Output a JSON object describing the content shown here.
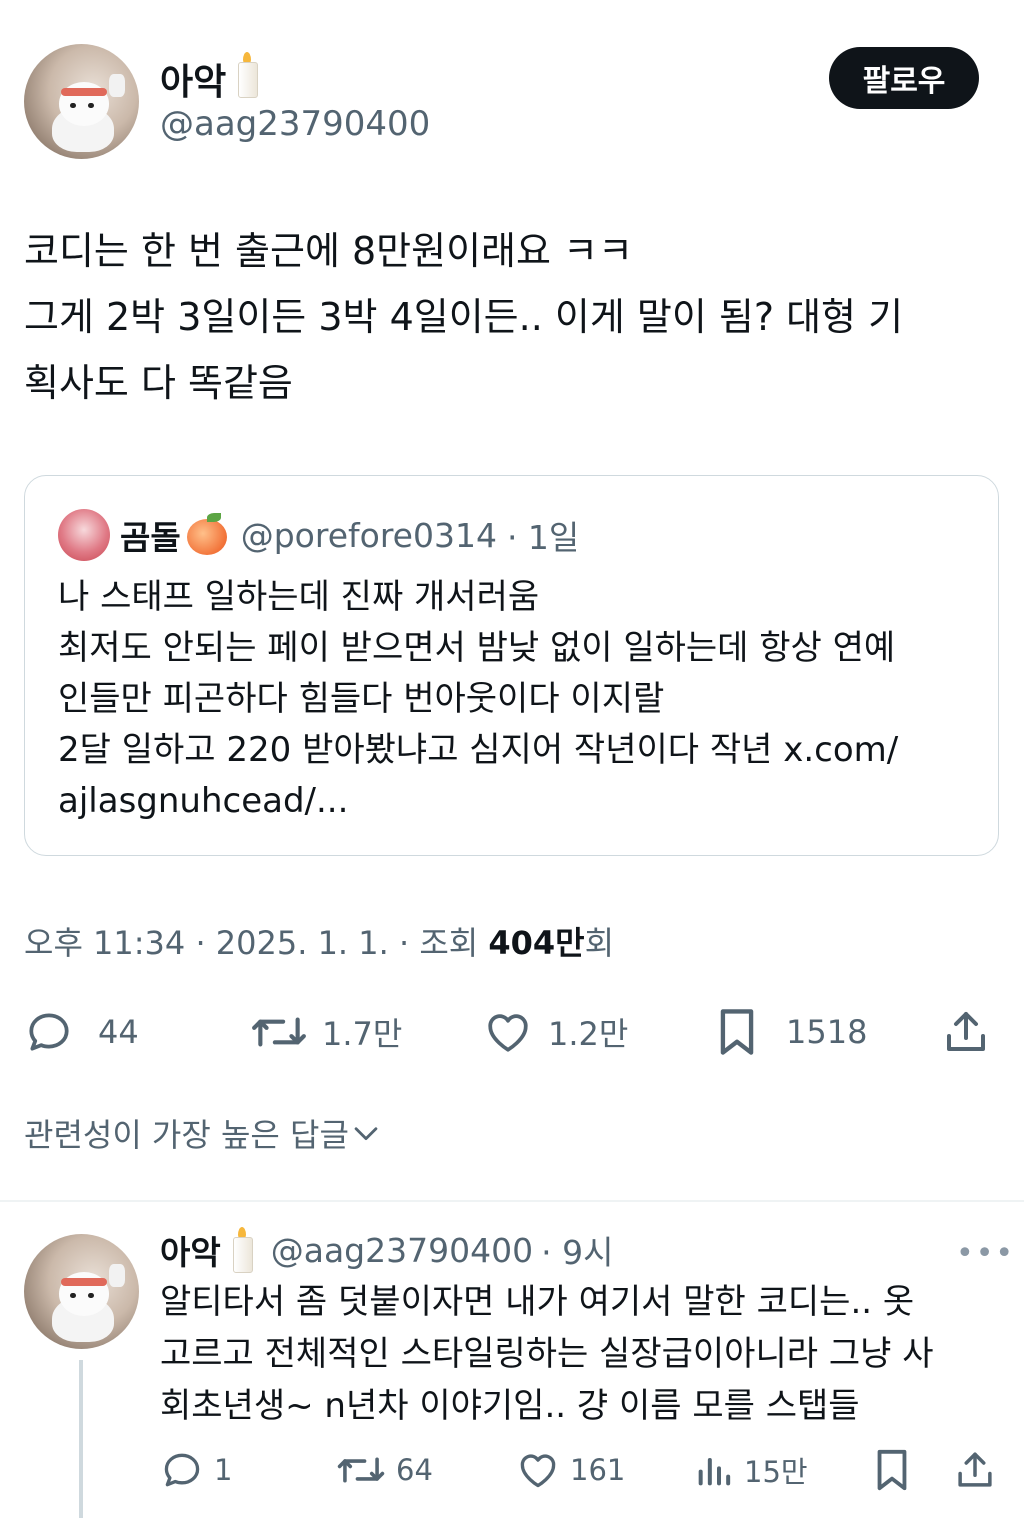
{
  "author": {
    "name": "아악",
    "handle": "@aag23790400"
  },
  "follow_label": "팔로우",
  "tweet_lines": [
    "코디는 한 번 출근에 8만원이래요 ㅋㅋ",
    "그게 2박 3일이든 3박 4일이든.. 이게 말이 됨? 대형 기",
    "획사도 다 똑같음"
  ],
  "quote": {
    "name": "곰돌",
    "handle": "@porefore0314",
    "time": "· 1일",
    "lines": [
      "나 스태프 일하는데 진짜 개서러움",
      "최저도 안되는 페이 받으면서 밤낮 없이 일하는데 항상 연예",
      "인들만 피곤하다 힘들다 번아웃이다 이지랄",
      "2달 일하고 220 받아봤냐고 심지어 작년이다 작년 x.com/",
      "ajlasgnuhcead/..."
    ]
  },
  "meta": {
    "prefix": "오후 11:34 · 2025. 1. 1. · 조회 ",
    "views": "404만",
    "suffix": "회"
  },
  "actions": {
    "reply": "44",
    "retweet": "1.7만",
    "like": "1.2만",
    "bookmark": "1518"
  },
  "sort_label": "관련성이 가장 높은 답글",
  "reply": {
    "name": "아악",
    "handle": "@aag23790400",
    "time": "· 9시",
    "more": "•••",
    "lines": [
      "알티타서 좀 덧붙이자면 내가 여기서 말한 코디는.. 옷",
      "고르고 전체적인 스타일링하는 실장급이아니라 그냥 사",
      "회초년생~ n년차 이야기임.. 걍 이름 모를 스탭들"
    ],
    "actions": {
      "reply": "1",
      "retweet": "64",
      "like": "161",
      "views": "15만"
    }
  },
  "icons": [
    "candle-icon",
    "peach-icon",
    "reply-icon",
    "retweet-icon",
    "like-icon",
    "bookmark-icon",
    "share-icon",
    "views-icon",
    "chevron-down-icon"
  ]
}
